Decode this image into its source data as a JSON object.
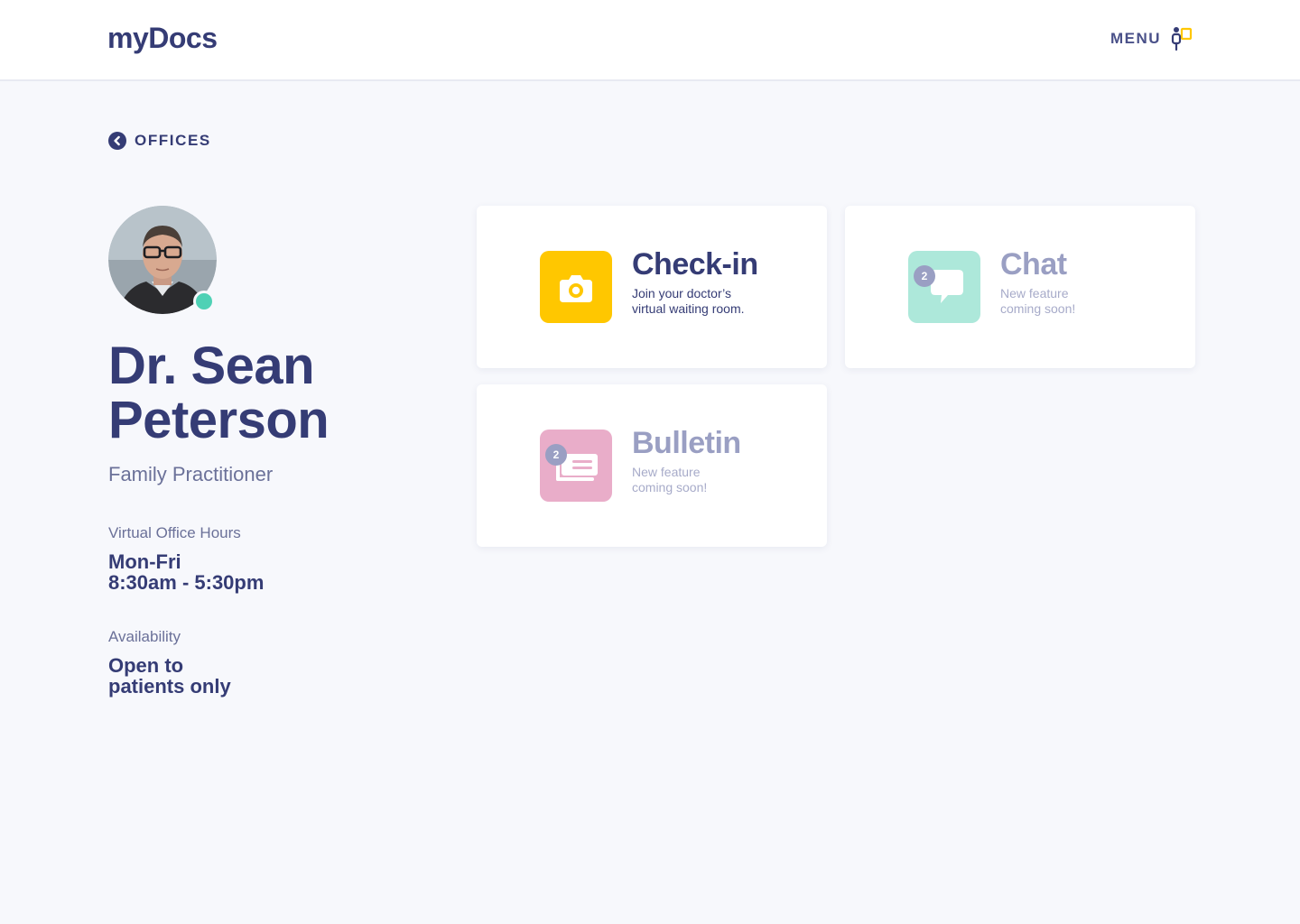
{
  "header": {
    "logo": "myDocs",
    "menu_label": "MENU",
    "menu_icon": "person-door-icon"
  },
  "breadcrumb": {
    "back_label": "OFFICES",
    "back_icon": "chevron-left-circle-icon"
  },
  "doctor": {
    "name": "Dr. Sean Peterson",
    "specialty": "Family Practitioner",
    "status_color": "#4fd1b5",
    "office_hours_label": "Virtual Office Hours",
    "office_hours_days": "Mon-Fri",
    "office_hours_time": "8:30am - 5:30pm",
    "availability_label": "Availability",
    "availability_line1": "Open to",
    "availability_line2": "patients only"
  },
  "cards": {
    "checkin": {
      "title": "Check-in",
      "sub_line1": "Join your doctor’s",
      "sub_line2": "virtual waiting room.",
      "icon": "camera-icon",
      "color": "#ffc700"
    },
    "chat": {
      "title": "Chat",
      "sub_line1": "New feature",
      "sub_line2": "coming soon!",
      "badge": "2",
      "icon": "chat-bubble-icon",
      "color": "#ade8da"
    },
    "bulletin": {
      "title": "Bulletin",
      "sub_line1": "New feature",
      "sub_line2": "coming soon!",
      "badge": "2",
      "icon": "newspaper-icon",
      "color": "#e9adc9"
    }
  }
}
